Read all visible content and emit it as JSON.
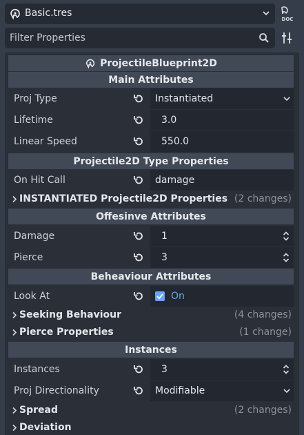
{
  "resource": {
    "name": "Basic.tres"
  },
  "filter": {
    "placeholder": "Filter Properties"
  },
  "inspector": {
    "class_name": "ProjectileBlueprint2D",
    "sections": {
      "main": "Main Attributes",
      "type_props": "Projectile2D Type Properties",
      "offensive": "Offesinve Attributes",
      "behaviour": "Beheaviour Attributes",
      "instances": "Instances"
    },
    "props": {
      "proj_type": {
        "label": "Proj Type",
        "value": "Instantiated"
      },
      "lifetime": {
        "label": "Lifetime",
        "value": "3.0"
      },
      "linear_speed": {
        "label": "Linear Speed",
        "value": "550.0"
      },
      "on_hit_call": {
        "label": "On Hit Call",
        "value": "damage"
      },
      "damage": {
        "label": "Damage",
        "value": "1"
      },
      "pierce": {
        "label": "Pierce",
        "value": "3"
      },
      "look_at": {
        "label": "Look At",
        "value": "On"
      },
      "instances": {
        "label": "Instances",
        "value": "3"
      },
      "proj_directionality": {
        "label": "Proj Directionality",
        "value": "Modifiable"
      }
    },
    "groups": {
      "instantiated": {
        "label": "INSTANTIATED Projectile2D Properties",
        "changes": "(2 changes)"
      },
      "seeking": {
        "label": "Seeking Behaviour",
        "changes": "(4 changes)"
      },
      "pierce_props": {
        "label": "Pierce Properties",
        "changes": "(1 change)"
      },
      "spread": {
        "label": "Spread",
        "changes": "(2 changes)"
      },
      "deviation": {
        "label": "Deviation",
        "changes": ""
      }
    }
  },
  "colors": {
    "background": "#363d4a",
    "panel": "#2a2f38",
    "section_header": "#414957",
    "field": "#222730",
    "accent": "#6aa6f0",
    "muted_text": "#8c919a"
  },
  "icons": {
    "resource": "godot-resource-icon",
    "dropdown": "chevron-down-icon",
    "doc": "doc-icon",
    "search": "search-icon",
    "tools": "tools-icon",
    "revert": "revert-icon",
    "spinner": "spinner-arrows-icon",
    "group": "chevron-right-icon",
    "check": "checkbox-checked-icon"
  }
}
